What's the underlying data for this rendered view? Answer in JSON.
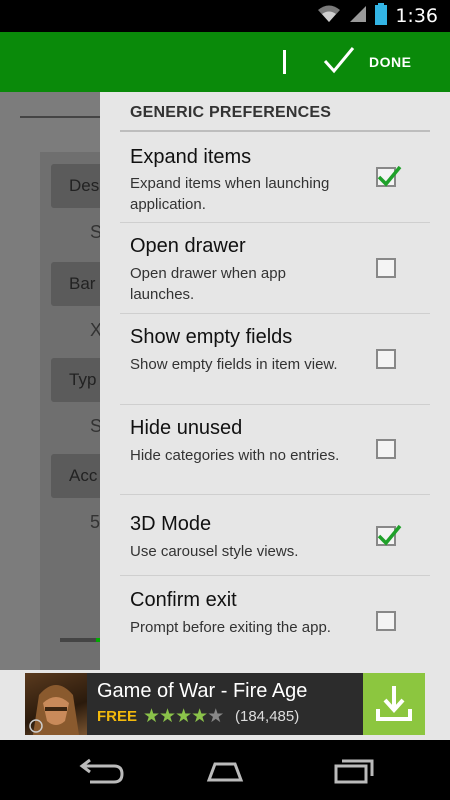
{
  "status_bar": {
    "time": "1:36",
    "icons": [
      "wifi-icon",
      "cell-signal-icon",
      "battery-icon"
    ]
  },
  "action_bar": {
    "done_label": "DONE",
    "icon": "check-icon",
    "color": "#0a8a0a"
  },
  "background_screen": {
    "chips": [
      "Des",
      "Bar",
      "Typ",
      "Acc"
    ],
    "values": [
      "S",
      "X",
      "S",
      "5"
    ]
  },
  "preferences": {
    "section_title": "GENERIC PREFERENCES",
    "items": [
      {
        "title": "Expand items",
        "summary": "Expand items when launching application.",
        "checked": true
      },
      {
        "title": "Open drawer",
        "summary": "Open drawer when app launches.",
        "checked": false
      },
      {
        "title": "Show empty fields",
        "summary": "Show empty fields in item view.",
        "checked": false
      },
      {
        "title": "Hide unused",
        "summary": "Hide categories with no entries.",
        "checked": false
      },
      {
        "title": "3D Mode",
        "summary": "Use carousel style views.",
        "checked": true
      },
      {
        "title": "Confirm exit",
        "summary": "Prompt before exiting the app.",
        "checked": false
      }
    ]
  },
  "ad": {
    "title": "Game of War - Fire Age",
    "price": "FREE",
    "rating": 4,
    "reviews": "(184,485)",
    "icon": "download-icon"
  },
  "nav_bar": {
    "buttons": [
      "back-icon",
      "home-icon",
      "recents-icon"
    ]
  }
}
